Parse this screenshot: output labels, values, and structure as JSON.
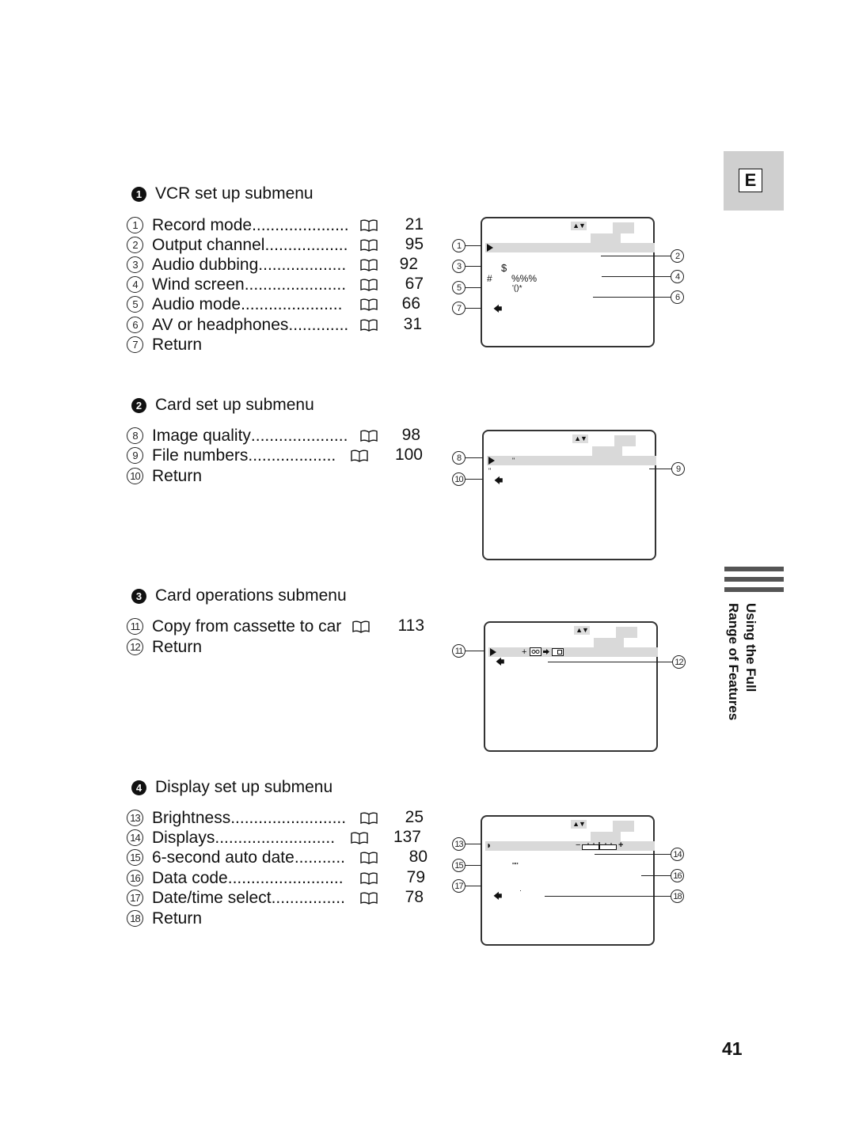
{
  "sections": [
    {
      "num": "1",
      "title": "VCR set up submenu",
      "items": [
        {
          "num": "1",
          "label": "Record mode",
          "dots": ".....................",
          "page": "21"
        },
        {
          "num": "2",
          "label": "Output channel",
          "dots": "..................",
          "page": "95"
        },
        {
          "num": "3",
          "label": "Audio dubbing",
          "dots": "...................",
          "page": "92"
        },
        {
          "num": "4",
          "label": "Wind screen",
          "dots": "......................",
          "page": "67"
        },
        {
          "num": "5",
          "label": "Audio mode",
          "dots": "......................",
          "page": "66"
        },
        {
          "num": "6",
          "label": "AV or headphones",
          "dots": ".............",
          "page": "31"
        },
        {
          "num": "7",
          "label": "Return",
          "dots": "",
          "page": ""
        }
      ]
    },
    {
      "num": "2",
      "title": "Card set up submenu",
      "items": [
        {
          "num": "8",
          "label": "Image quality",
          "dots": ".....................",
          "page": "98"
        },
        {
          "num": "9",
          "label": "File numbers",
          "dots": "...................",
          "page": "100"
        },
        {
          "num": "10",
          "label": "Return",
          "dots": "",
          "page": ""
        }
      ]
    },
    {
      "num": "3",
      "title": "Card operations submenu",
      "items": [
        {
          "num": "11",
          "label": "Copy from cassette to car",
          "dots": "",
          "page": "113"
        },
        {
          "num": "12",
          "label": "Return",
          "dots": "",
          "page": ""
        }
      ]
    },
    {
      "num": "4",
      "title": "Display set up submenu",
      "items": [
        {
          "num": "13",
          "label": "Brightness",
          "dots": ".........................",
          "page": "25"
        },
        {
          "num": "14",
          "label": "Displays",
          "dots": "..........................",
          "page": "137"
        },
        {
          "num": "15",
          "label": "6-second auto date",
          "dots": "...........",
          "page": "80"
        },
        {
          "num": "16",
          "label": "Data code",
          "dots": ".........................",
          "page": "79"
        },
        {
          "num": "17",
          "label": "Date/time select",
          "dots": "................",
          "page": "78"
        },
        {
          "num": "18",
          "label": "Return",
          "dots": "",
          "page": ""
        }
      ]
    }
  ],
  "screens": {
    "vcr": {
      "arrows": "▲▼",
      "row3_symbol": "$",
      "row4_left": "#",
      "row4_right": "%%%",
      "row5": "'()*"
    },
    "card": {
      "arrows": "▲▼",
      "row1_mark": "\"",
      "row2_mark": "\""
    },
    "ops": {
      "arrows": "▲▼",
      "plus": "+"
    },
    "display": {
      "arrows": "▲▼",
      "minus": "−",
      "plus": "+",
      "row2_mark": "'\"'",
      "row4_mark": "·"
    }
  },
  "side_tab": {
    "letter": "E",
    "line1": "Using the Full",
    "line2": "Range of Features"
  },
  "page_number": "41",
  "icons": {
    "book": "book-reference-icon",
    "back": "return-arrow-icon",
    "select": "play-cursor-icon"
  }
}
